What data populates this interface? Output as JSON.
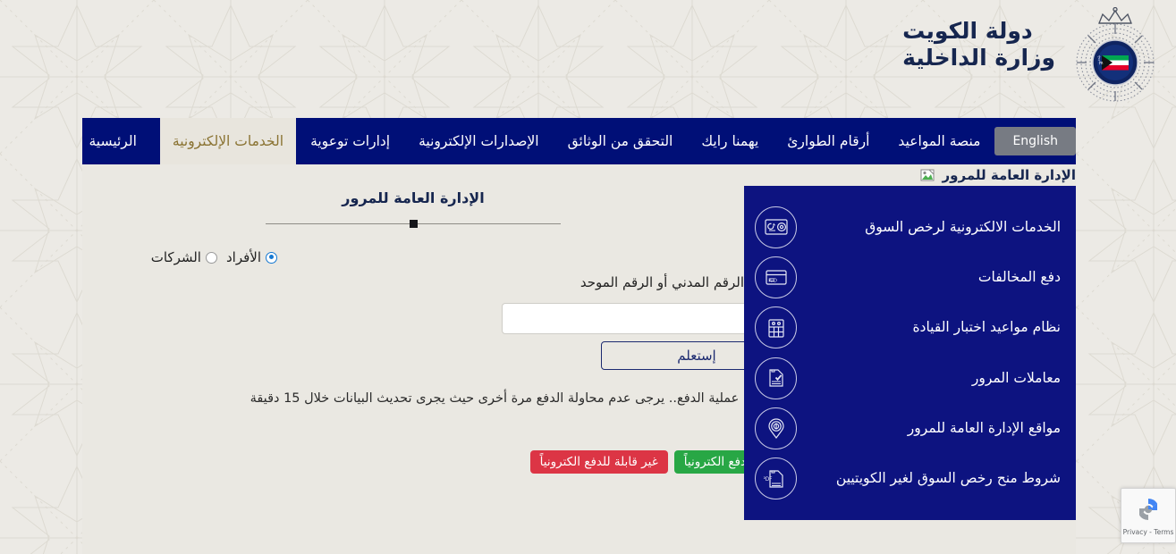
{
  "header": {
    "brand_line1": "دولة الكويت",
    "brand_line2": "وزارة الداخلية",
    "crest_name": "kuwait-police-crest",
    "crest_text_en": "KUWAIT POLICE",
    "brand_color": "#16264f"
  },
  "nav": {
    "lang_toggle": "English",
    "items": [
      {
        "label": "منصة المواعيد",
        "active": false
      },
      {
        "label": "أرقام الطوارئ",
        "active": false
      },
      {
        "label": "يهمنا رايك",
        "active": false
      },
      {
        "label": "التحقق من الوثائق",
        "active": false
      },
      {
        "label": "الإصدارات الإلكترونية",
        "active": false
      },
      {
        "label": "إدارات توعوية",
        "active": false
      },
      {
        "label": "الخدمات الإلكترونية",
        "active": true
      },
      {
        "label": "الرئيسية",
        "active": false
      }
    ],
    "bar_color": "#000f77",
    "active_bg": "#e8e5dd",
    "active_text": "#8a7332"
  },
  "breadcrumb": {
    "text": "الإدارة العامة للمرور",
    "icon": "broken-image-icon"
  },
  "service_panel": {
    "bg_color": "#0d1380",
    "items": [
      {
        "label": "الخدمات الالكترونية لرخص السوق",
        "icon": "license-card-icon"
      },
      {
        "label": "دفع المخالفات",
        "icon": "payment-card-kd-icon"
      },
      {
        "label": "نظام مواعيد اختبار القيادة",
        "icon": "calendar-icon"
      },
      {
        "label": "معاملات المرور",
        "icon": "document-check-icon"
      },
      {
        "label": "مواقع الإدارة العامة للمرور",
        "icon": "location-pin-icon"
      },
      {
        "label": "شروط منح رخص السوق لغير الكويتيين",
        "icon": "pdf-document-icon"
      }
    ]
  },
  "form": {
    "title": "الإدارة العامة للمرور",
    "radio_options": [
      {
        "label": "الأفراد",
        "checked": true
      },
      {
        "label": "الشركات",
        "checked": false
      }
    ],
    "field_label": "الرقم المدني أو الرقم الموحد",
    "input_value": "",
    "input_placeholder": "",
    "submit_label": "إستعلم",
    "notice": "بعد إجراء عملية الدفع.. يرجى عدم محاولة الدفع مرة أخرى حيث يجرى تحديث البيانات خلال 15 دقيقة",
    "legend": [
      {
        "label": "قابلة للدفع الكترونياً",
        "color": "#28a745"
      },
      {
        "label": "غير قابلة للدفع الكترونياً",
        "color": "#dc3545"
      }
    ]
  },
  "recaptcha": {
    "terms": "Privacy - Terms",
    "icon": "recaptcha-icon"
  }
}
